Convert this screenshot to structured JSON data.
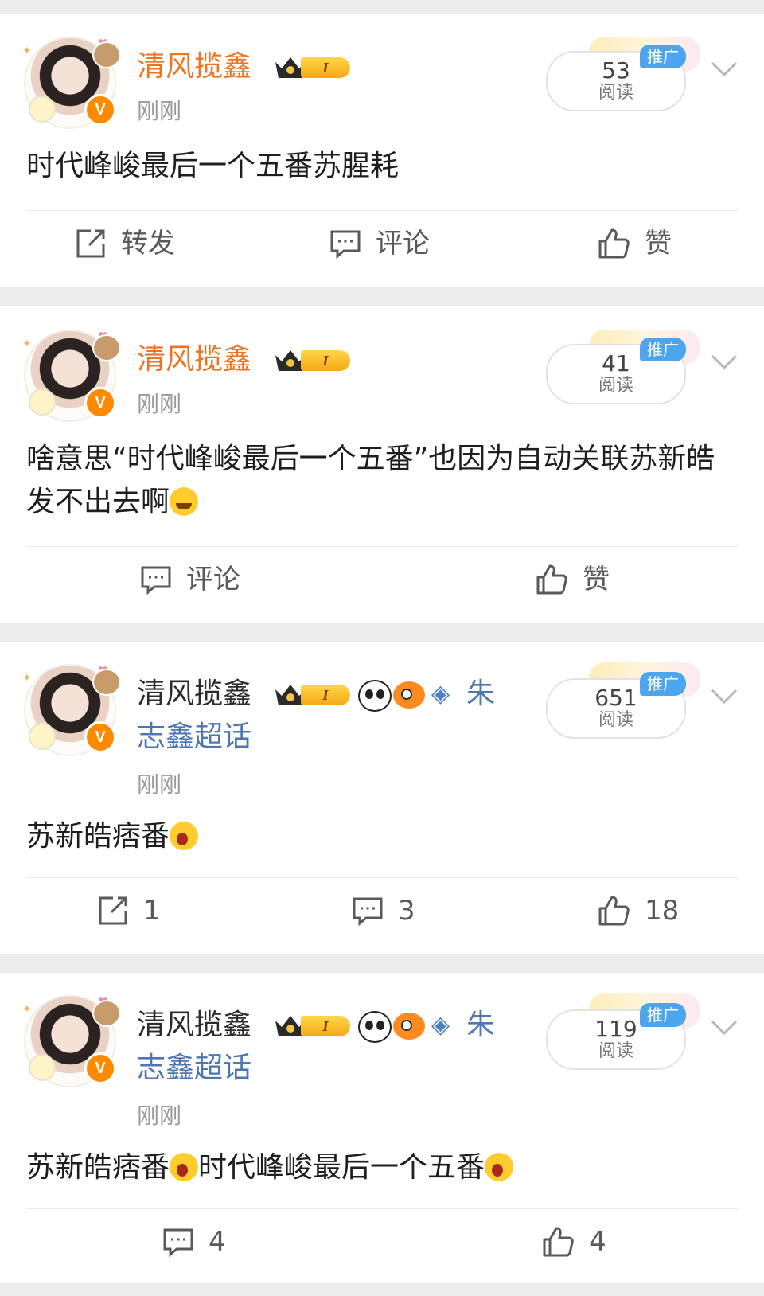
{
  "posts": [
    {
      "user": "清风揽鑫",
      "level": "I",
      "time": "刚刚",
      "text": "时代峰峻最后一个五番苏腥耗",
      "read_count": "53",
      "read_label": "阅读",
      "promo": "推广",
      "actions": {
        "repost": "转发",
        "comment": "评论",
        "like": "赞"
      }
    },
    {
      "user": "清风揽鑫",
      "level": "I",
      "time": "刚刚",
      "text": "啥意思“时代峰峻最后一个五番”也因为自动关联苏新皓发不出去啊",
      "read_count": "41",
      "read_label": "阅读",
      "promo": "推广",
      "actions": {
        "comment": "评论",
        "like": "赞"
      }
    },
    {
      "user": "清风揽鑫",
      "level": "I",
      "topic_line1": "朱",
      "topic_line2": "志鑫超话",
      "time": "刚刚",
      "text": "苏新皓痞番",
      "read_count": "651",
      "read_label": "阅读",
      "promo": "推广",
      "actions": {
        "repost": "1",
        "comment": "3",
        "like": "18"
      }
    },
    {
      "user": "清风揽鑫",
      "level": "I",
      "topic_line1": "朱",
      "topic_line2": "志鑫超话",
      "time": "刚刚",
      "text_a": "苏新皓痞番",
      "text_b": "时代峰峻最后一个五番",
      "read_count": "119",
      "read_label": "阅读",
      "promo": "推广",
      "actions": {
        "comment": "4",
        "like": "4"
      }
    }
  ],
  "icons": [
    "repost-icon",
    "comment-icon",
    "like-icon",
    "chevron-down-icon",
    "verified-v-icon",
    "crown-icon",
    "panda-icon",
    "fish-icon",
    "diamond-icon"
  ],
  "colors": {
    "username_orange": "#f07420",
    "topic_blue": "#4d76b2",
    "promo_blue": "#4ea5ef",
    "verified_orange": "#ff8a00"
  }
}
